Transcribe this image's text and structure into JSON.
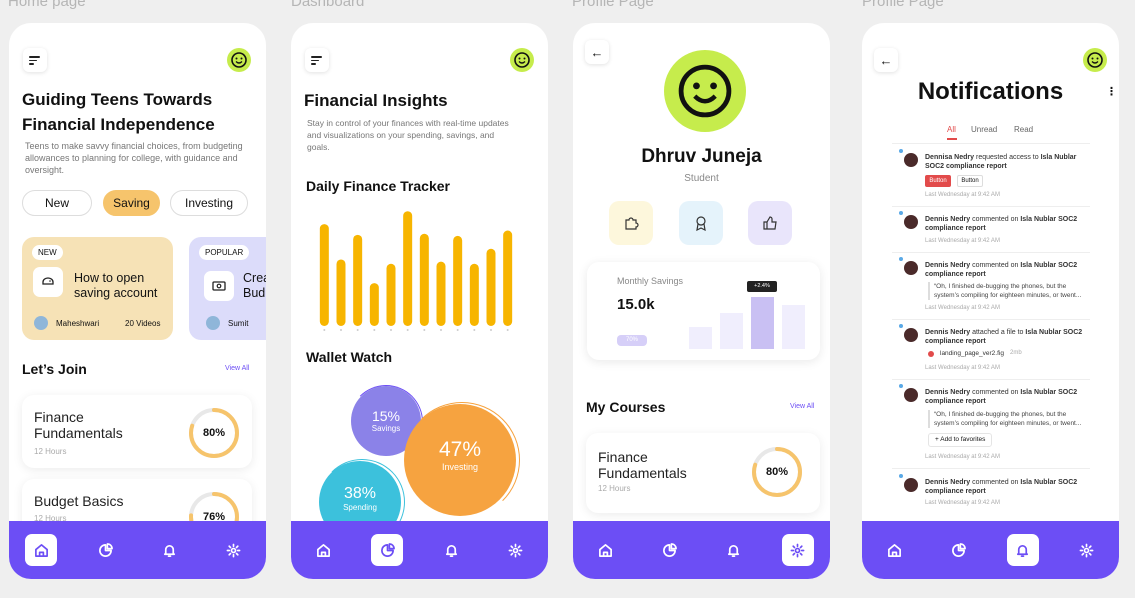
{
  "frame_labels": [
    "Home page",
    "Dashboard",
    "Profile Page",
    "Profile Page"
  ],
  "home": {
    "title_line1": "Guiding Teens Towards",
    "title_line2": "Financial Independence",
    "subtitle": "Teens to make savvy financial choices, from budgeting allowances to planning for college, with guidance and oversight.",
    "chips": [
      "New",
      "Saving",
      "Investing"
    ],
    "promo1": {
      "badge": "NEW",
      "title_line1": "How to open",
      "title_line2": "saving account",
      "author": "Maheshwari",
      "videos": "20 Videos"
    },
    "promo2": {
      "badge": "POPULAR",
      "title_line1": "Crea",
      "title_line2": "Bud",
      "author": "Sumit"
    },
    "section": "Let’s Join",
    "view_all": "View All",
    "course1": {
      "title": "Finance Fundamentals",
      "hours": "12 Hours",
      "progress": "80%",
      "fraction": 0.8
    },
    "course2": {
      "title": "Budget Basics",
      "hours": "12 Hours",
      "progress": "76%",
      "fraction": 0.76
    }
  },
  "dashboard": {
    "title": "Financial Insights",
    "subtitle": "Stay in control of your finances with real-time updates and visualizations on your spending, savings, and goals.",
    "tracker_title": "Daily Finance Tracker",
    "wallet_title": "Wallet Watch",
    "bubbles": [
      {
        "pct": "15%",
        "label": "Savings",
        "color": "#8b82e8"
      },
      {
        "pct": "47%",
        "label": "Investing",
        "color": "#f6a340"
      },
      {
        "pct": "38%",
        "label": "Spending",
        "color": "#3cc1dc"
      }
    ]
  },
  "chart_data": {
    "type": "bar",
    "title": "Daily Finance Tracker",
    "values": [
      95,
      62,
      85,
      40,
      58,
      107,
      86,
      60,
      84,
      58,
      72,
      89
    ],
    "ylim": [
      0,
      110
    ],
    "color": "#f7b500"
  },
  "profile": {
    "name": "Dhruv Juneja",
    "role": "Student",
    "savings_label": "Monthly Savings",
    "savings_value": "15.0k",
    "tooltip": "+2.4%",
    "pill": "70%",
    "courses_title": "My Courses",
    "view_all": "View All",
    "course": {
      "title": "Finance Fundamentals",
      "hours": "12 Hours",
      "progress": "80%",
      "fraction": 0.8
    }
  },
  "notifications": {
    "title": "Notifications",
    "tabs": [
      "All",
      "Unread",
      "Read"
    ],
    "n1": {
      "who": "Dennisa Nedry",
      "text": "requested access to",
      "target": "Isla Nublar SOC2 compliance report",
      "btn1": "Button",
      "btn2": "Button",
      "time": "Last Wednesday at 9:42 AM"
    },
    "n2": {
      "who": "Dennis Nedry",
      "text": "commented on",
      "target": "Isla Nublar SOC2 compliance report",
      "time": "Last Wednesday at 9:42 AM"
    },
    "n3": {
      "who": "Dennis Nedry",
      "text": "commented on",
      "target": "Isla Nublar SOC2 compliance report",
      "quote": "“Oh, I finished de-bugging the phones, but the system’s compiling for eighteen minutes, or twent...",
      "time": "Last Wednesday at 9:42 AM"
    },
    "n4": {
      "who": "Dennis Nedry",
      "text": "attached a file to",
      "target": "Isla Nublar SOC2 compliance report",
      "file": "landing_page_ver2.fig",
      "size": "2mb",
      "time": "Last Wednesday at 9:42 AM"
    },
    "n5": {
      "who": "Dennis Nedry",
      "text": "commented on",
      "target": "Isla Nublar SOC2 compliance report",
      "quote": "“Oh, I finished de-bugging the phones, but the system’s compiling for eighteen minutes, or twent...",
      "fav": "+  Add to favorites",
      "time": "Last Wednesday at 9:42 AM"
    },
    "n6": {
      "who": "Dennis Nedry",
      "text": "commented on",
      "target": "Isla Nublar SOC2 compliance report",
      "time": "Last Wednesday at 9:42 AM"
    }
  }
}
